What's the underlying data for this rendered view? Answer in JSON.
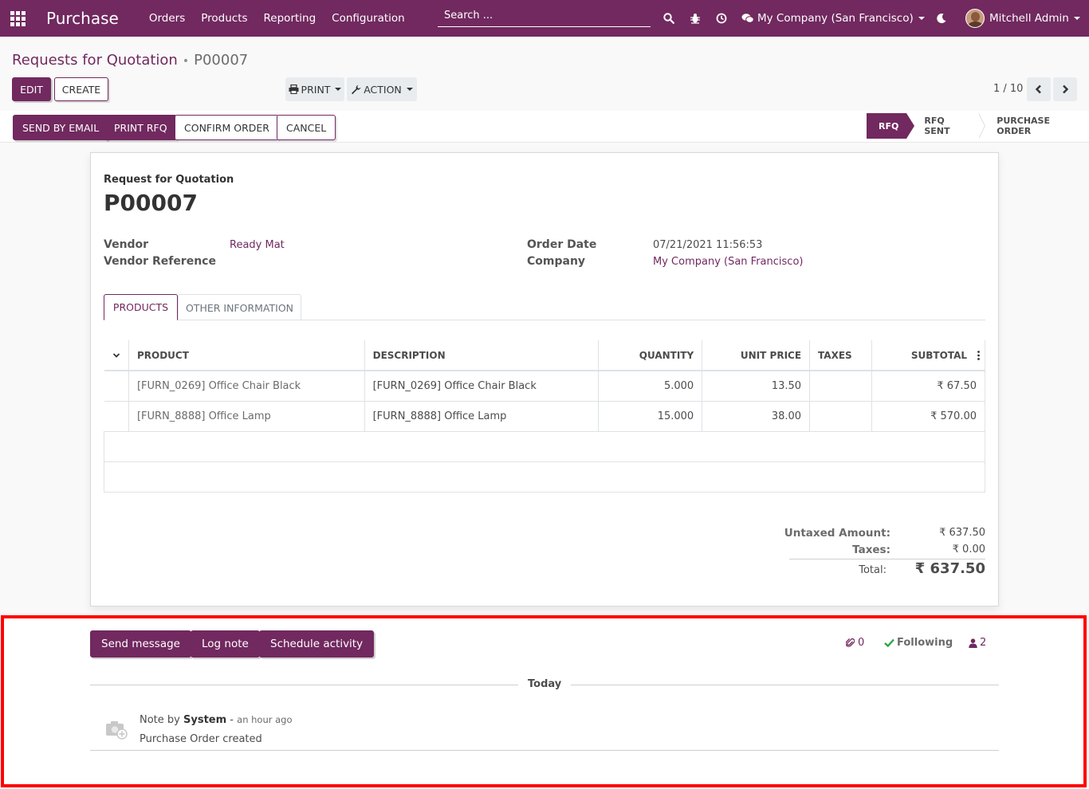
{
  "navbar": {
    "app_name": "Purchase",
    "menu": [
      "Orders",
      "Products",
      "Reporting",
      "Configuration"
    ],
    "search_placeholder": "Search ...",
    "company": "My Company (San Francisco)",
    "user": "Mitchell Admin"
  },
  "control_panel": {
    "breadcrumb_parent": "Requests for Quotation",
    "breadcrumb_separator": "•",
    "breadcrumb_current": "P00007",
    "edit_label": "EDIT",
    "create_label": "CREATE",
    "print_label": "PRINT",
    "action_label": "ACTION",
    "pager": "1 / 10"
  },
  "statusbar": {
    "buttons": [
      "SEND BY EMAIL",
      "PRINT RFQ",
      "CONFIRM ORDER",
      "CANCEL"
    ],
    "stages": [
      {
        "label": "RFQ",
        "current": true
      },
      {
        "label": "RFQ SENT",
        "current": false
      },
      {
        "label": "PURCHASE ORDER",
        "current": false
      }
    ]
  },
  "sheet": {
    "doc_label": "Request for Quotation",
    "doc_name": "P00007",
    "vendor_label": "Vendor",
    "vendor_value": "Ready Mat",
    "vendor_ref_label": "Vendor Reference",
    "order_date_label": "Order Date",
    "order_date_value": "07/21/2021 11:56:53",
    "company_label": "Company",
    "company_value": "My Company (San Francisco)",
    "tabs": [
      "PRODUCTS",
      "OTHER INFORMATION"
    ],
    "columns": [
      "PRODUCT",
      "DESCRIPTION",
      "QUANTITY",
      "UNIT PRICE",
      "TAXES",
      "SUBTOTAL"
    ],
    "lines": [
      {
        "product": "[FURN_0269] Office Chair Black",
        "description": "[FURN_0269] Office Chair Black",
        "quantity": "5.000",
        "unit_price": "13.50",
        "taxes": "",
        "subtotal": "₹ 67.50"
      },
      {
        "product": "[FURN_8888] Office Lamp",
        "description": "[FURN_8888] Office Lamp",
        "quantity": "15.000",
        "unit_price": "38.00",
        "taxes": "",
        "subtotal": "₹ 570.00"
      }
    ],
    "totals": {
      "untaxed_label": "Untaxed Amount:",
      "untaxed_value": "₹ 637.50",
      "taxes_label": "Taxes:",
      "taxes_value": "₹ 0.00",
      "total_label": "Total:",
      "total_value": "₹ 637.50"
    }
  },
  "chatter": {
    "send_message": "Send message",
    "log_note": "Log note",
    "schedule_activity": "Schedule activity",
    "attachments_count": "0",
    "following_label": "Following",
    "followers_count": "2",
    "date_separator": "Today",
    "message": {
      "prefix": "Note by",
      "author": "System",
      "dash": "-",
      "time": "an hour ago",
      "body": "Purchase Order created"
    }
  },
  "colors": {
    "brand": "#71295f",
    "highlight_border": "#ff0000"
  }
}
